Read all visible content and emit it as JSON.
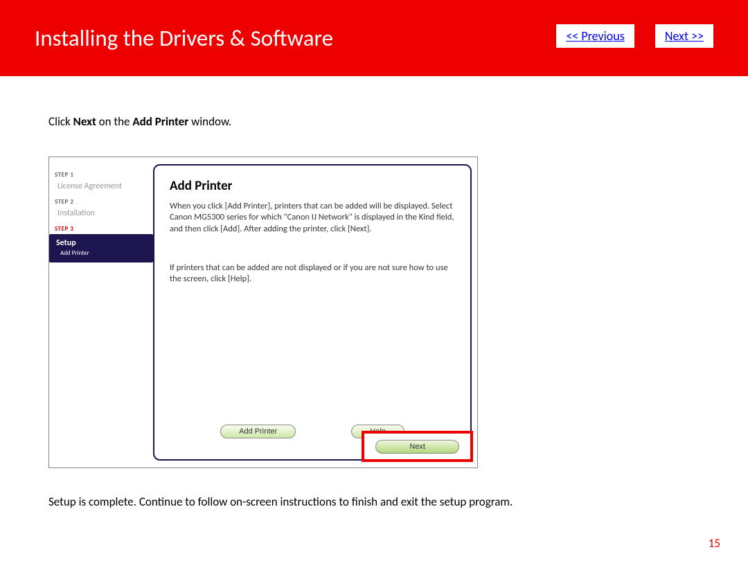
{
  "header": {
    "title": "Installing the Drivers & Software",
    "prev": "<< Previous",
    "next": "Next >>"
  },
  "instruction": {
    "pre": "Click ",
    "b1": "Next",
    "mid": " on the  ",
    "b2": "Add Printer",
    "post": " window."
  },
  "sidebar": {
    "step1": "STEP 1",
    "step1name": "License Agreement",
    "step2": "STEP 2",
    "step2name": "Installation",
    "step3": "STEP 3",
    "setup": "Setup",
    "sub": "Add Printer"
  },
  "dialog": {
    "heading": "Add Printer",
    "para1": "When you click [Add Printer], printers that can be added will be displayed. Select Canon MG5300 series for which \"Canon IJ Network\" is displayed in the Kind field, and then click [Add]. After adding the printer, click [Next].",
    "para2": "If printers that can be added are not displayed or if you are not sure how to use the screen, click [Help].",
    "add": "Add Printer",
    "help": "Help",
    "nextbtn": "Next"
  },
  "posttext": "Setup is complete.  Continue to follow on-screen instructions to finish and exit the setup program.",
  "pagenum": "15"
}
